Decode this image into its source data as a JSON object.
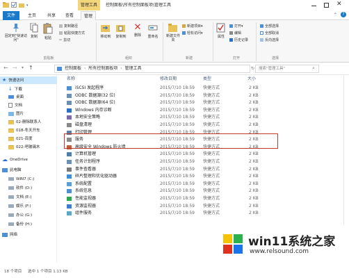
{
  "window": {
    "tools_label": "管理工具",
    "path_title": "控制面板\\所有控制面板项\\管理工具"
  },
  "tabs": [
    "文件",
    "主页",
    "共享",
    "查看",
    "管理"
  ],
  "ribbon": {
    "clipboard": {
      "pin_label": "固定到\"快速访问\"",
      "copy_label": "复制",
      "paste_label": "粘贴",
      "copy_path": "复制路径",
      "paste_shortcut": "粘贴快捷方式",
      "cut": "剪切",
      "group": "剪贴板"
    },
    "organize": {
      "move_to": "移动到",
      "copy_to": "复制到",
      "delete": "删除",
      "rename": "重命名",
      "group": "组织"
    },
    "new": {
      "new_folder": "新建文件夹",
      "new_item": "新建项目▾",
      "easy_access": "轻松访问▾",
      "group": "新建"
    },
    "open": {
      "properties": "属性",
      "open": "打开▾",
      "edit": "编辑",
      "history": "历史记录",
      "group": "打开"
    },
    "select": {
      "select_all": "全部选择",
      "select_none": "全部取消",
      "invert": "反向选择",
      "group": "选择"
    }
  },
  "address": {
    "crumbs": [
      "控制面板",
      "所有控制面板项",
      "管理工具"
    ],
    "search_placeholder": "搜索\"管理工具\""
  },
  "nav": {
    "quick_access": "快速访问",
    "items": [
      "下载",
      "桌面",
      "文档",
      "图片",
      "02-删除联系人",
      "018-冬天开车",
      "021-百度",
      "022-吧玻璃木"
    ],
    "onedrive": "OneDrive",
    "this_pc": "此电脑",
    "drives": [
      "WIN7 (C:)",
      "软件 (D:)",
      "文档 (E:)",
      "娱乐 (F:)",
      "办公 (G:)",
      "备份 (H:)"
    ],
    "network": "网络"
  },
  "columns": {
    "name": "名称",
    "date": "修改日期",
    "type": "类型",
    "size": "大小"
  },
  "files": [
    {
      "name": "iSCSI 发起程序",
      "date": "2015/7/10 18:59",
      "type": "快捷方式",
      "size": "2 KB"
    },
    {
      "name": "ODBC 数据源(32 位)",
      "date": "2015/7/10 18:59",
      "type": "快捷方式",
      "size": "2 KB"
    },
    {
      "name": "ODBC 数据源(64 位)",
      "date": "2015/7/10 18:59",
      "type": "快捷方式",
      "size": "2 KB"
    },
    {
      "name": "Windows 内存诊断",
      "date": "2015/7/10 18:59",
      "type": "快捷方式",
      "size": "2 KB"
    },
    {
      "name": "本地安全策略",
      "date": "2015/7/10 18:59",
      "type": "快捷方式",
      "size": "2 KB"
    },
    {
      "name": "磁盘清理",
      "date": "2015/7/10 18:59",
      "type": "快捷方式",
      "size": "2 KB"
    },
    {
      "name": "打印管理",
      "date": "2015/7/10 18:59",
      "type": "快捷方式",
      "size": "2 KB"
    },
    {
      "name": "服务",
      "date": "2015/7/10 18:59",
      "type": "快捷方式",
      "size": "2 KB"
    },
    {
      "name": "高级安全 Windows 防火墙",
      "date": "2015/7/10 18:59",
      "type": "快捷方式",
      "size": "2 KB"
    },
    {
      "name": "计算机管理",
      "date": "2015/7/10 18:59",
      "type": "快捷方式",
      "size": "2 KB"
    },
    {
      "name": "任务计划程序",
      "date": "2015/7/10 18:59",
      "type": "快捷方式",
      "size": "2 KB"
    },
    {
      "name": "事件查看器",
      "date": "2015/7/10 18:59",
      "type": "快捷方式",
      "size": "2 KB"
    },
    {
      "name": "碎片整理和优化驱动器",
      "date": "2015/7/10 18:59",
      "type": "快捷方式",
      "size": "2 KB"
    },
    {
      "name": "系统配置",
      "date": "2015/7/10 18:59",
      "type": "快捷方式",
      "size": "2 KB"
    },
    {
      "name": "系统信息",
      "date": "2015/7/10 18:59",
      "type": "快捷方式",
      "size": "2 KB"
    },
    {
      "name": "性能监视器",
      "date": "2015/7/10 18:59",
      "type": "快捷方式",
      "size": "2 KB"
    },
    {
      "name": "资源监视器",
      "date": "2015/7/10 18:59",
      "type": "快捷方式",
      "size": "2 KB"
    },
    {
      "name": "组件服务",
      "date": "2015/7/10 18:59",
      "type": "快捷方式",
      "size": "2 KB"
    }
  ],
  "status": {
    "count": "18 个项目",
    "selected": "选中 1 个项目 1.13 KB"
  },
  "watermark": {
    "brand": "win11系统之家",
    "url": "www.relsound.com"
  },
  "colors": {
    "accent": "#1979ca",
    "tools_tab": "#f3d67a",
    "highlight": "#c0392b"
  }
}
